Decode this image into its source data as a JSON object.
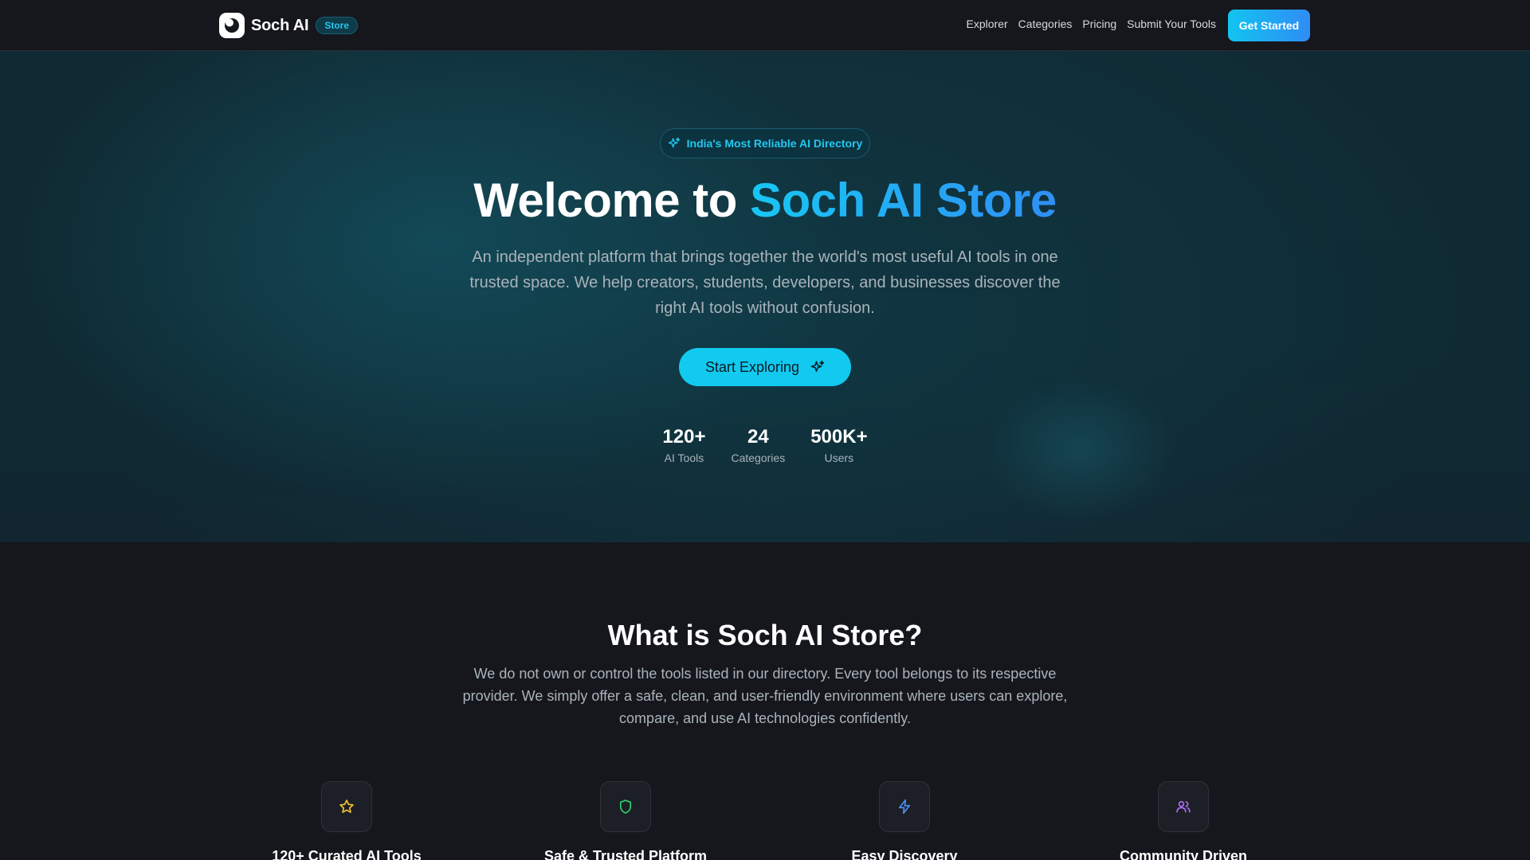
{
  "navbar": {
    "brand_name": "Soch AI",
    "brand_badge": "Store",
    "links": [
      "Explorer",
      "Categories",
      "Pricing",
      "Submit Your Tools"
    ],
    "cta_label": "Get Started"
  },
  "hero": {
    "badge_text": "India's Most Reliable AI Directory",
    "title_prefix": "Welcome to",
    "title_highlight": "Soch AI Store",
    "description": "An independent platform that brings together the world's most useful AI tools in one trusted space. We help creators, students, developers, and businesses discover the right AI tools without confusion.",
    "button_label": "Start Exploring",
    "stats": [
      {
        "value": "120+",
        "label": "AI Tools"
      },
      {
        "value": "24",
        "label": "Categories"
      },
      {
        "value": "500K+",
        "label": "Users"
      }
    ]
  },
  "about": {
    "title": "What is Soch AI Store?",
    "description": "We do not own or control the tools listed in our directory. Every tool belongs to its respective provider. We simply offer a safe, clean, and user-friendly environment where users can explore, compare, and use AI technologies confidently.",
    "features": [
      {
        "title": "120+ Curated AI Tools",
        "icon": "star-icon",
        "color": "#f5c431"
      },
      {
        "title": "Safe & Trusted Platform",
        "icon": "shield-icon",
        "color": "#2fd16a"
      },
      {
        "title": "Easy Discovery",
        "icon": "lightning-icon",
        "color": "#4f8df5"
      },
      {
        "title": "Community Driven",
        "icon": "users-icon",
        "color": "#b06cf5"
      }
    ]
  },
  "colors": {
    "accent": "#12c9ef",
    "accent_gradient_end": "#2f8cf5",
    "background": "#15171d"
  }
}
